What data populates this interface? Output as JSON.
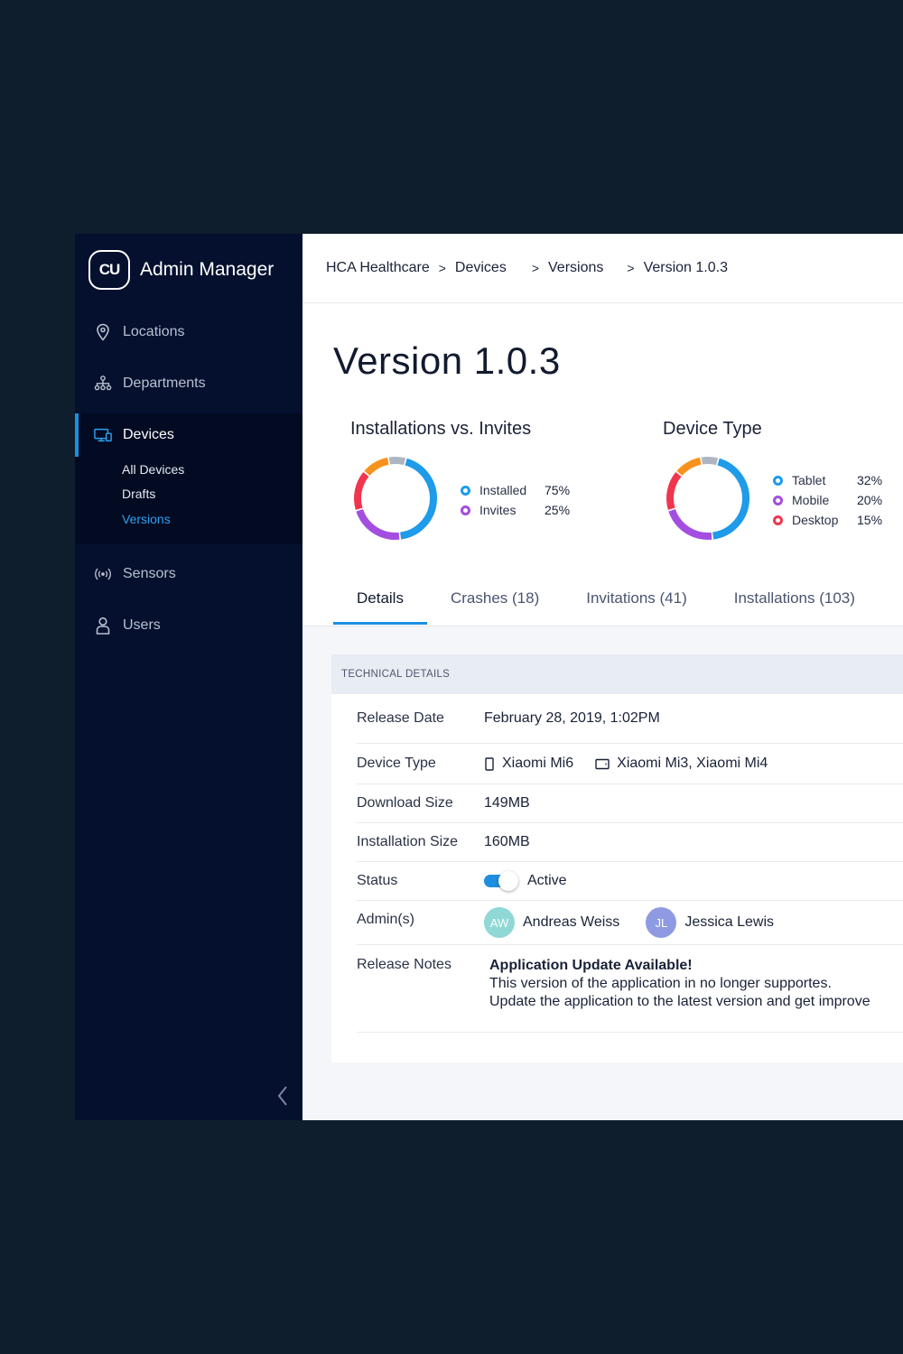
{
  "brand": {
    "logo_text": "CU",
    "title": "Admin Manager"
  },
  "sidebar": {
    "items": [
      {
        "label": "Locations",
        "icon": "location-pin-icon"
      },
      {
        "label": "Departments",
        "icon": "org-chart-icon"
      },
      {
        "label": "Devices",
        "icon": "devices-icon"
      },
      {
        "label": "Sensors",
        "icon": "sensor-icon"
      },
      {
        "label": "Users",
        "icon": "user-icon"
      }
    ],
    "devices_sub": [
      {
        "label": "All Devices"
      },
      {
        "label": "Drafts"
      },
      {
        "label": "Versions"
      }
    ],
    "collapse_icon": "chevron-left-icon"
  },
  "breadcrumb": [
    "HCA Healthcare",
    "Devices",
    "Versions",
    "Version 1.0.3"
  ],
  "breadcrumb_separator": ">",
  "page_title": "Version 1.0.3",
  "charts": {
    "installs": {
      "title": "Installations vs. Invites",
      "legend": [
        {
          "label": "Installed",
          "value": "75%",
          "color": "#1e9be9"
        },
        {
          "label": "Invites",
          "value": "25%",
          "color": "#a34ee0"
        }
      ]
    },
    "device_type": {
      "title": "Device Type",
      "legend": [
        {
          "label": "Tablet",
          "value": "32%",
          "color": "#1e9be9"
        },
        {
          "label": "Mobile",
          "value": "20%",
          "color": "#a34ee0"
        },
        {
          "label": "Desktop",
          "value": "15%",
          "color": "#f0364e"
        }
      ]
    }
  },
  "chart_data": [
    {
      "type": "pie",
      "title": "Installations vs. Invites",
      "categories": [
        "Installed",
        "Invites"
      ],
      "values": [
        75,
        25
      ],
      "segments_drawn": [
        {
          "color": "#1e9be9",
          "value": 44
        },
        {
          "color": "#a34ee0",
          "value": 22
        },
        {
          "color": "#f0364e",
          "value": 16
        },
        {
          "color": "#f7921e",
          "value": 11
        },
        {
          "color": "#aeb5c2",
          "value": 7
        }
      ]
    },
    {
      "type": "pie",
      "title": "Device Type",
      "categories": [
        "Tablet",
        "Mobile",
        "Desktop"
      ],
      "values": [
        32,
        20,
        15
      ],
      "segments_drawn": [
        {
          "color": "#1e9be9",
          "value": 44
        },
        {
          "color": "#a34ee0",
          "value": 22
        },
        {
          "color": "#f0364e",
          "value": 16
        },
        {
          "color": "#f7921e",
          "value": 11
        },
        {
          "color": "#aeb5c2",
          "value": 7
        }
      ]
    }
  ],
  "tabs": [
    {
      "label": "Details",
      "active": true
    },
    {
      "label": "Crashes (18)"
    },
    {
      "label": "Invitations (41)"
    },
    {
      "label": "Installations (103)"
    }
  ],
  "tech": {
    "header": "TECHNICAL DETAILS",
    "release_date": {
      "label": "Release Date",
      "value": "February 28, 2019, 1:02PM"
    },
    "device_type": {
      "label": "Device Type",
      "mobile": "Xiaomi Mi6",
      "tablet": "Xiaomi Mi3, Xiaomi Mi4"
    },
    "download_size": {
      "label": "Download Size",
      "value": "149MB"
    },
    "installation_size": {
      "label": "Installation Size",
      "value": "160MB"
    },
    "status": {
      "label": "Status",
      "value": "Active",
      "enabled": true
    },
    "admins": {
      "label": "Admin(s)",
      "people": [
        {
          "initials": "AW",
          "name": "Andreas Weiss",
          "color": "#8fd8d6"
        },
        {
          "initials": "JL",
          "name": "Jessica Lewis",
          "color": "#8e9be3"
        }
      ]
    },
    "release_notes": {
      "label": "Release Notes",
      "title": "Application Update Available!",
      "line1": "This version of the application in no longer supportes.",
      "line2": "Update the application to the latest version and get improve"
    }
  },
  "colors": {
    "accent": "#1e8ee0",
    "sidebar_bg": "#04102e",
    "page_bg": "#0f1e2c"
  }
}
